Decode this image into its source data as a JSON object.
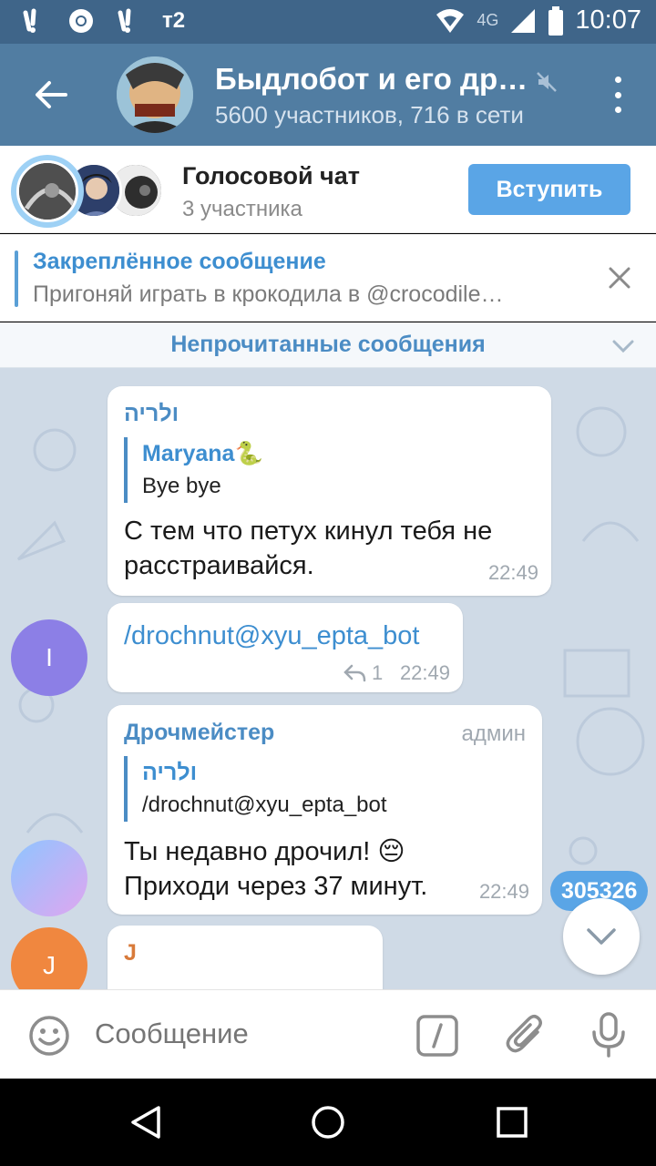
{
  "status_bar": {
    "carrier": "т2",
    "network": "4G",
    "time": "10:07"
  },
  "header": {
    "title": "Быдлобот и его др…",
    "subtitle": "5600 участников, 716 в сети"
  },
  "voice_chat": {
    "title": "Голосовой чат",
    "participants": "3 участника",
    "join_label": "Вступить"
  },
  "pinned": {
    "title": "Закреплённое сообщение",
    "text": "Пригоняй играть в крокодила в @crocodile…"
  },
  "unread_label": "Непрочитанные сообщения",
  "messages": [
    {
      "sender": "ולריה",
      "reply_to_name": "Maryana🐍",
      "reply_to_text": "Bye bye",
      "text_line1": "С тем что петух кинул тебя не",
      "text_line2": "расстраивайся.",
      "time": "22:49"
    },
    {
      "avatar_letter": "I",
      "text": "/drochnut@xyu_epta_bot",
      "replies": "1",
      "time": "22:49"
    },
    {
      "sender": "Дрочмейстер",
      "role": "админ",
      "reply_to_name": "ולריה",
      "reply_to_text": "/drochnut@xyu_epta_bot",
      "text_line1": "Ты недавно дрочил! 😔",
      "text_line2": "Приходи через 37 минут.",
      "time": "22:49"
    },
    {
      "avatar_letter": "J",
      "sender": "J"
    }
  ],
  "unread_badge": "305326",
  "input": {
    "placeholder": "Сообщение"
  },
  "colors": {
    "header": "#517da2",
    "status_bar": "#3f6589",
    "accent": "#5aa5e6",
    "chat_bg": "#cfdae6"
  }
}
